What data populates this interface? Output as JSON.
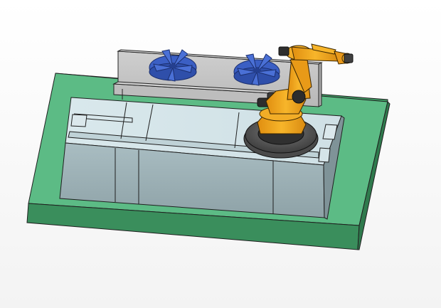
{
  "viewport": {
    "background": "#f4f4f4"
  },
  "scene": {
    "base_color": "#56b57f",
    "base_side_color": "#3f9a63",
    "track_top_color": "#d6e6ea",
    "track_side_color": "#9eb3b8",
    "fixture_color": "#c9c9c9",
    "fan_color": "#3f63c7",
    "robot_color": "#f1a51f",
    "turntable_color": "#5a5a5a",
    "objects": [
      "green-base-plate",
      "linear-track",
      "fixture-table",
      "fan-impeller-left",
      "fan-impeller-right",
      "robot-turntable",
      "industrial-robot-arm"
    ]
  }
}
